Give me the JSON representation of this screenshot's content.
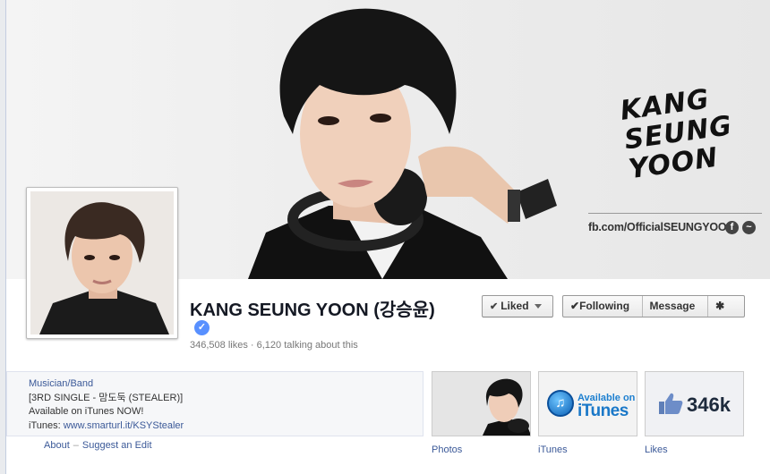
{
  "page": {
    "name": "KANG SEUNG YOON (강승윤)",
    "likes": "346,508 likes",
    "talking": "6,120 talking about this",
    "separator": "·"
  },
  "cover": {
    "brand_lines": [
      "KANG",
      "SEUNG",
      "YOON"
    ],
    "url": "fb.com/OfficialSEUNGYOON"
  },
  "actions": {
    "liked": "Liked",
    "following": "Following",
    "message": "Message",
    "gear": "✱"
  },
  "about": {
    "category": "Musician/Band",
    "line1": "[3RD SINGLE - 맘도둑 (STEALER)]",
    "line2": "Available on iTunes NOW!",
    "line3_prefix": "iTunes: ",
    "line3_link": "www.smarturl.it/KSYStealer",
    "about_link": "About",
    "sep": "–",
    "suggest_link": "Suggest an Edit"
  },
  "tiles": {
    "photos_label": "Photos",
    "itunes_label": "iTunes",
    "itunes_small": "Available on",
    "itunes_big": "iTunes",
    "likes_label": "Likes",
    "likes_count": "346k"
  },
  "colors": {
    "link": "#3b5998",
    "verified": "#5890ff",
    "itunes": "#1a78c8"
  }
}
